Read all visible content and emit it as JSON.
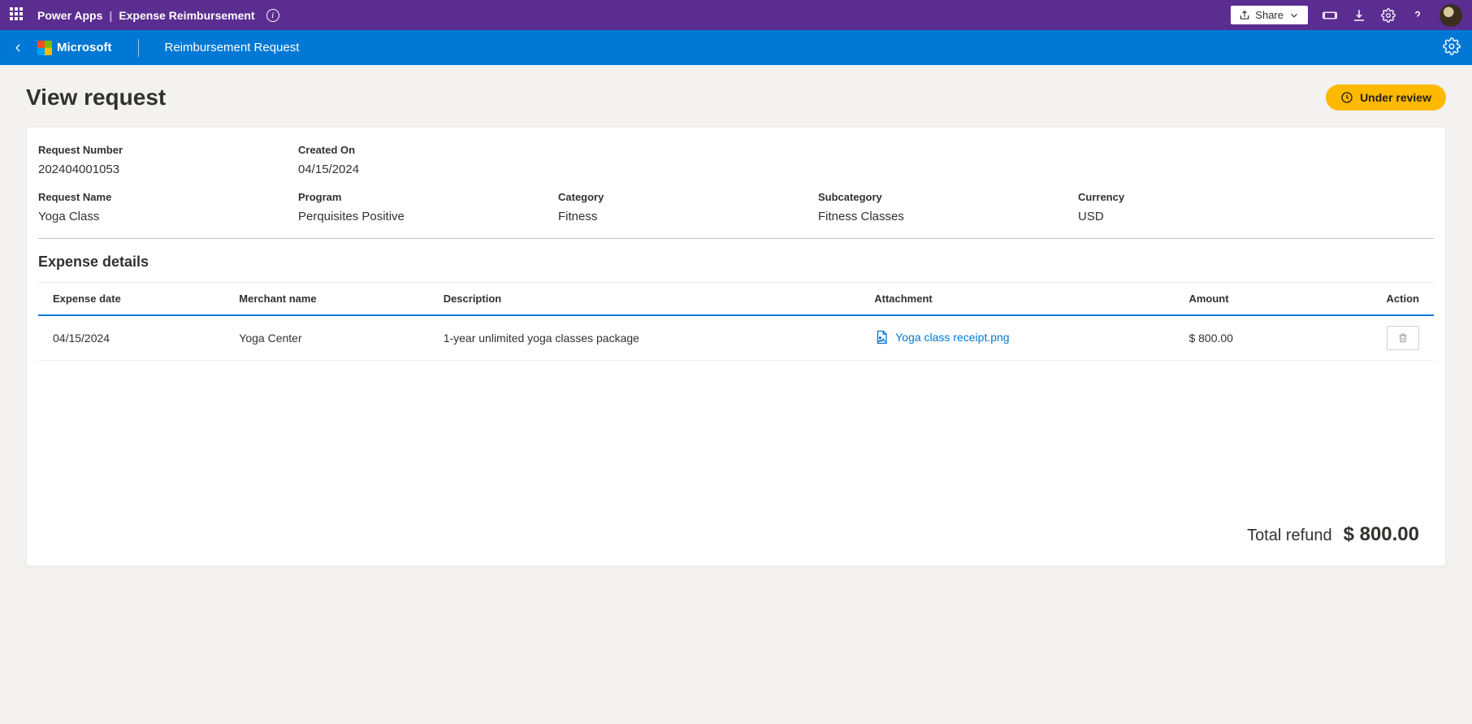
{
  "topbar": {
    "app": "Power Apps",
    "separator": "|",
    "context": "Expense Reimbursement",
    "share_label": "Share"
  },
  "app_header": {
    "brand": "Microsoft",
    "page": "Reimbursement Request"
  },
  "page": {
    "title": "View request",
    "status": "Under review"
  },
  "request": {
    "number_label": "Request Number",
    "number": "202404001053",
    "created_label": "Created On",
    "created": "04/15/2024",
    "name_label": "Request Name",
    "name": "Yoga Class",
    "program_label": "Program",
    "program": "Perquisites Positive",
    "category_label": "Category",
    "category": "Fitness",
    "subcategory_label": "Subcategory",
    "subcategory": "Fitness Classes",
    "currency_label": "Currency",
    "currency": "USD"
  },
  "expense": {
    "section_title": "Expense details",
    "columns": {
      "date": "Expense date",
      "merchant": "Merchant name",
      "description": "Description",
      "attachment": "Attachment",
      "amount": "Amount",
      "action": "Action"
    },
    "row": {
      "date": "04/15/2024",
      "merchant": "Yoga Center",
      "description": "1-year unlimited yoga classes package",
      "attachment": "Yoga class receipt.png",
      "amount": "$ 800.00"
    },
    "total_label": "Total refund",
    "total_amount": "$ 800.00"
  }
}
